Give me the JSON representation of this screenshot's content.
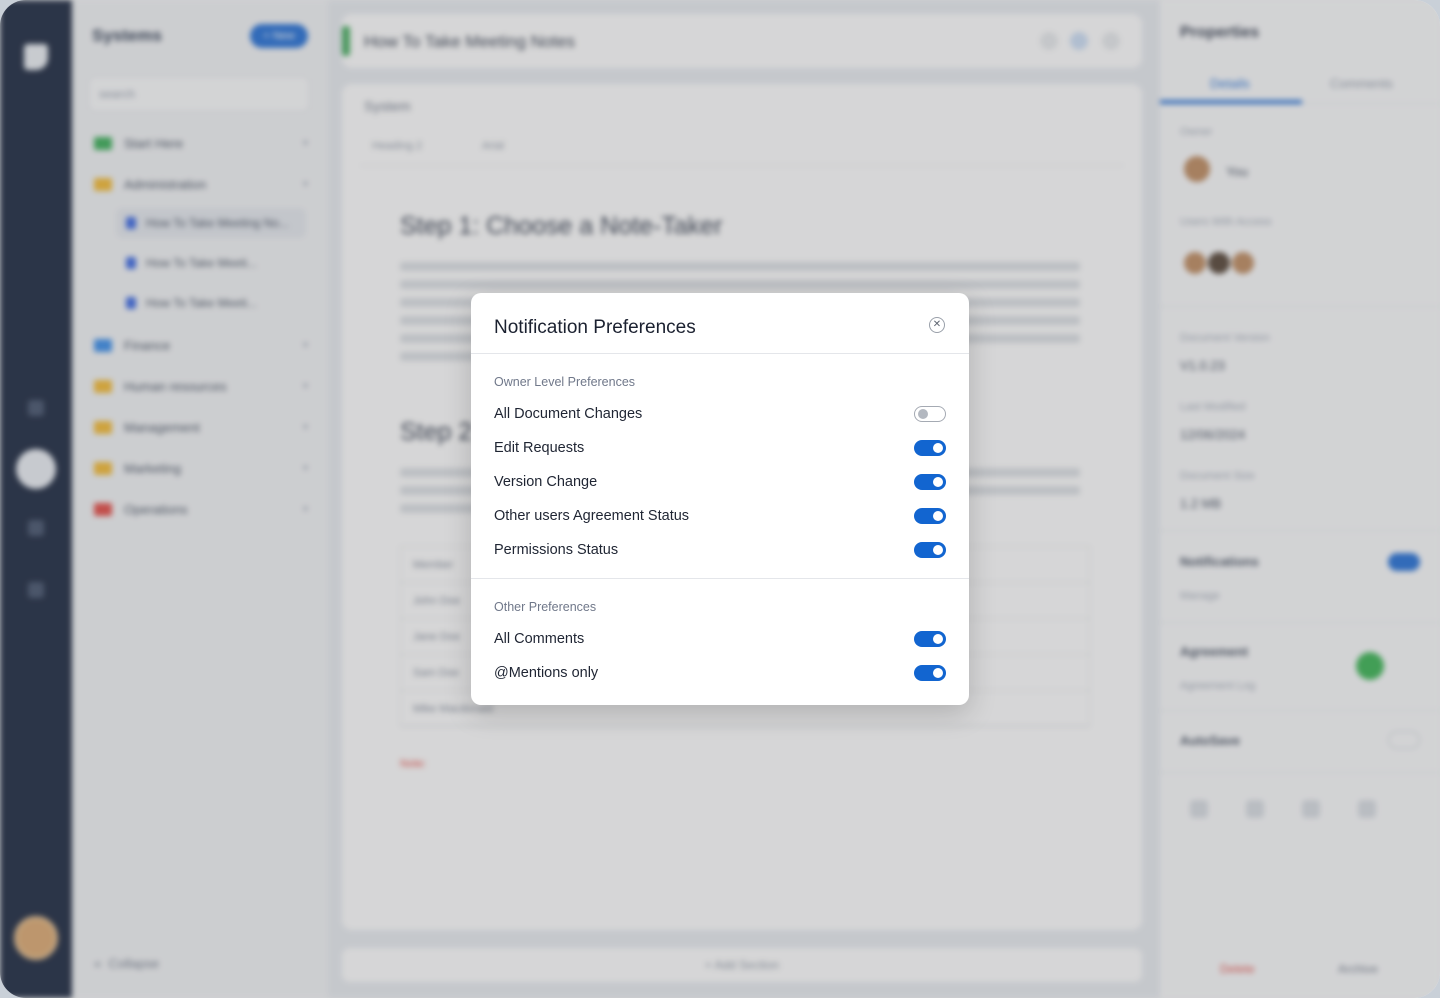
{
  "background": {
    "nav": {
      "title": "Systems",
      "new_button": "+ New",
      "search_placeholder": "search",
      "folders": [
        {
          "label": "Start Here",
          "color": "#2fa84f"
        },
        {
          "label": "Administration",
          "color": "#f0b429"
        },
        {
          "label": "Finance",
          "color": "#2f86e8"
        },
        {
          "label": "Human resources",
          "color": "#f0b429"
        },
        {
          "label": "Management",
          "color": "#f0b429"
        },
        {
          "label": "Marketing",
          "color": "#f0b429"
        },
        {
          "label": "Operations",
          "color": "#e0403b"
        }
      ],
      "docs": [
        "How To Take Meeting No...",
        "How To Take Meeti...",
        "How To Take Meeti..."
      ],
      "collapse": "Collapse"
    },
    "document": {
      "title": "How To Take Meeting Notes",
      "section": "System",
      "toolbar": {
        "style": "Heading 2",
        "font": "Arial"
      },
      "step1_heading": "Step 1: Choose a Note-Taker",
      "step2_heading": "Step 2",
      "table_header": "Member",
      "table_rows": [
        "John Doe",
        "Jane Doe",
        "Sam Doe",
        "Mike Macdonald"
      ],
      "note_label": "Note:",
      "add_section": "+ Add Section"
    },
    "properties": {
      "title": "Properties",
      "tabs": [
        "Details",
        "Comments"
      ],
      "owner_label": "Owner",
      "owner_name": "You",
      "users_label": "Users With Access",
      "version_label": "Document Version",
      "version_value": "V1.0.23",
      "modified_label": "Last Modified",
      "modified_value": "12/06/2024",
      "size_label": "Document Size",
      "size_value": "1.2 MB",
      "notifications_label": "Notifications",
      "notifications_sub": "Manage",
      "agreement_label": "Agreement",
      "agreement_sub": "Agreement Log",
      "autosave_label": "AutoSave",
      "delete": "Delete",
      "archive": "Archive",
      "accent": "#1867d3",
      "danger": "#e0403b"
    }
  },
  "modal": {
    "title": "Notification Preferences",
    "owner_section": {
      "label": "Owner Level Preferences",
      "items": [
        {
          "label": "All Document Changes",
          "enabled": false
        },
        {
          "label": "Edit Requests",
          "enabled": true
        },
        {
          "label": "Version Change",
          "enabled": true
        },
        {
          "label": "Other users Agreement Status",
          "enabled": true
        },
        {
          "label": "Permissions Status",
          "enabled": true
        }
      ]
    },
    "other_section": {
      "label": "Other Preferences",
      "items": [
        {
          "label": "All Comments",
          "enabled": true
        },
        {
          "label": "@Mentions only",
          "enabled": true
        }
      ]
    },
    "toggle_on_color": "#1265d0",
    "close_icon": "close-icon"
  }
}
